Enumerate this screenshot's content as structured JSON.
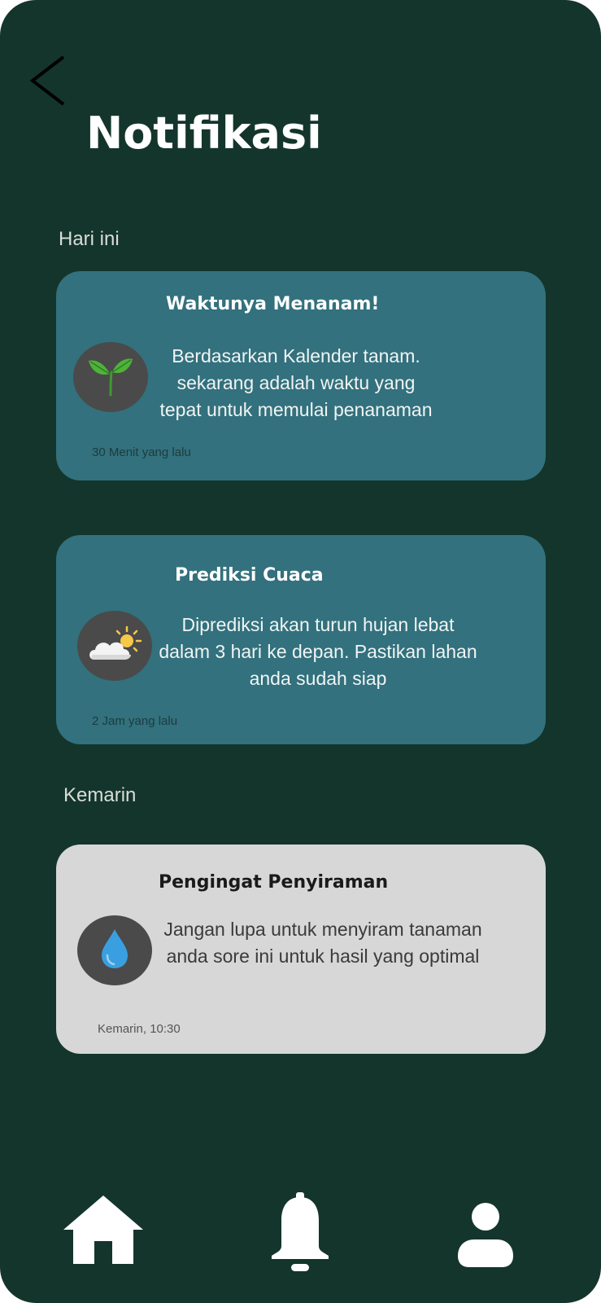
{
  "header": {
    "title": "Notifikasi",
    "back_icon": "chevron-left-icon"
  },
  "sections": {
    "today_label": "Hari ini",
    "yesterday_label": "Kemarin"
  },
  "notifications": [
    {
      "title": "Waktunya Menanam!",
      "body": "Berdasarkan Kalender tanam. sekarang adalah waktu yang tepat untuk memulai penanaman",
      "time": "30 Menit yang lalu",
      "icon": "sprout-icon"
    },
    {
      "title": "Prediksi Cuaca",
      "body": "Diprediksi akan turun hujan lebat dalam 3 hari ke depan. Pastikan lahan anda sudah siap",
      "time": "2 Jam yang lalu",
      "icon": "partly-cloudy-icon"
    },
    {
      "title": "Pengingat Penyiraman",
      "body": "Jangan lupa untuk menyiram tanaman anda sore ini untuk hasil yang optimal",
      "time": "Kemarin, 10:30",
      "icon": "water-drop-icon"
    }
  ],
  "bottom_nav": {
    "items": [
      "home-icon",
      "bell-icon",
      "user-icon"
    ]
  },
  "colors": {
    "background": "#14352b",
    "card_teal": "#32717d",
    "card_gray": "#d7d7d7",
    "icon_circle": "#4a4a4a"
  }
}
